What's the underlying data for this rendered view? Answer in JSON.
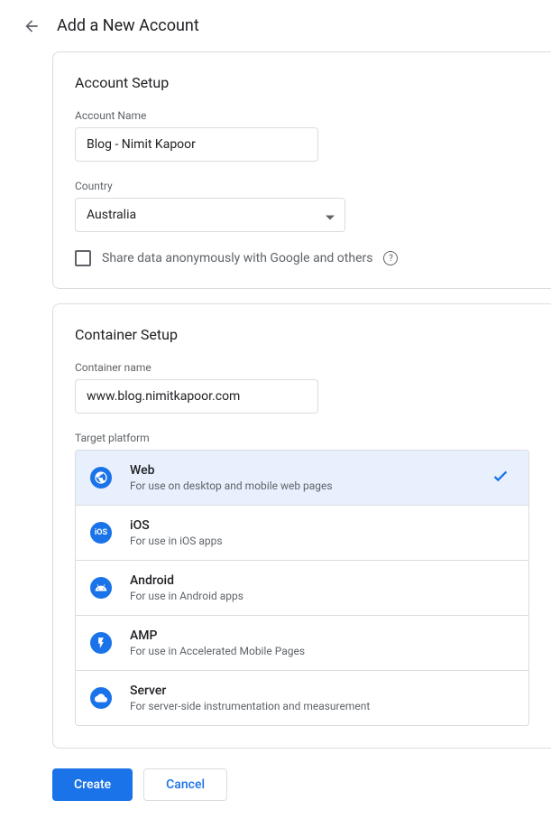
{
  "header": {
    "title": "Add a New Account"
  },
  "account_setup": {
    "title": "Account Setup",
    "name_label": "Account Name",
    "name_value": "Blog - Nimit Kapoor",
    "country_label": "Country",
    "country_value": "Australia",
    "share_label": "Share data anonymously with Google and others"
  },
  "container_setup": {
    "title": "Container Setup",
    "name_label": "Container name",
    "name_value": "www.blog.nimitkapoor.com",
    "platform_label": "Target platform",
    "platforms": [
      {
        "name": "Web",
        "desc": "For use on desktop and mobile web pages",
        "selected": true
      },
      {
        "name": "iOS",
        "desc": "For use in iOS apps",
        "selected": false
      },
      {
        "name": "Android",
        "desc": "For use in Android apps",
        "selected": false
      },
      {
        "name": "AMP",
        "desc": "For use in Accelerated Mobile Pages",
        "selected": false
      },
      {
        "name": "Server",
        "desc": "For server-side instrumentation and measurement",
        "selected": false
      }
    ]
  },
  "actions": {
    "create": "Create",
    "cancel": "Cancel"
  }
}
